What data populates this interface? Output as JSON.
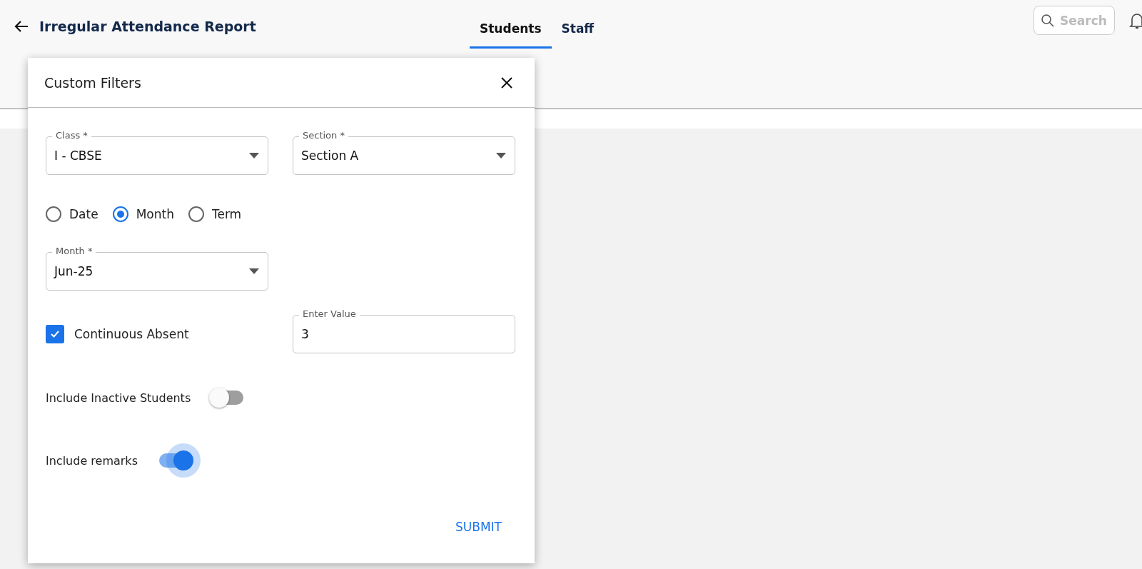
{
  "header": {
    "title": "Irregular Attendance Report",
    "search": {
      "placeholder": "Search"
    }
  },
  "tabs": [
    {
      "label": "Students",
      "selected": true
    },
    {
      "label": "Staff",
      "selected": false
    }
  ],
  "dialog": {
    "title": "Custom Filters",
    "class_field": {
      "label": "Class *",
      "value": "I - CBSE"
    },
    "section_field": {
      "label": "Section *",
      "value": "Section A"
    },
    "period_options": [
      {
        "label": "Date",
        "selected": false
      },
      {
        "label": "Month",
        "selected": true
      },
      {
        "label": "Term",
        "selected": false
      }
    ],
    "month_field": {
      "label": "Month *",
      "value": "Jun-25"
    },
    "continuous_absent": {
      "label": "Continuous Absent",
      "checked": true
    },
    "value_field": {
      "label": "Enter Value",
      "value": "3"
    },
    "toggles": [
      {
        "label": "Include Inactive Students",
        "on": false
      },
      {
        "label": "Include remarks",
        "on": true
      }
    ],
    "submit": "SUBMIT"
  }
}
